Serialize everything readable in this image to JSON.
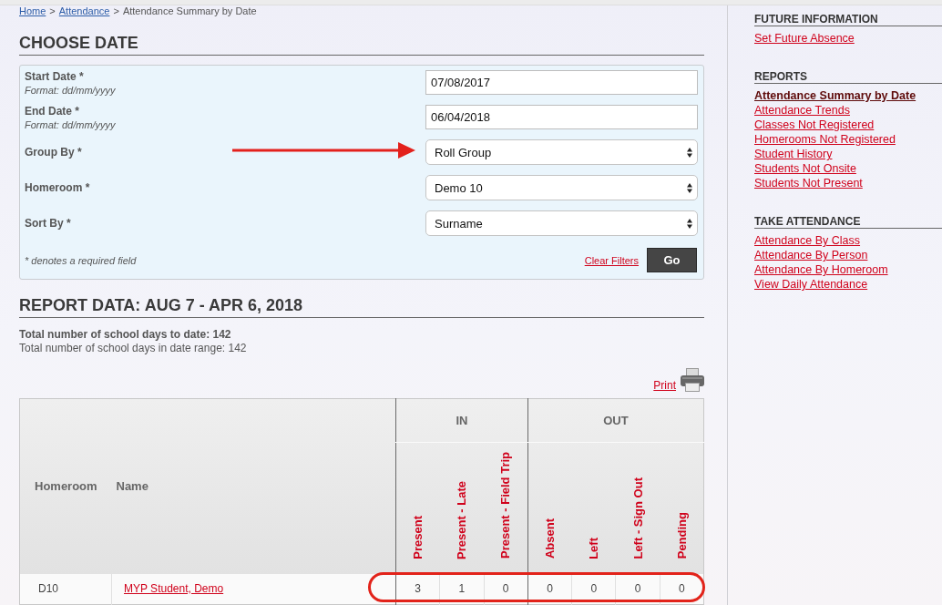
{
  "breadcrumb": {
    "separator": ">",
    "items": [
      {
        "label": "Home",
        "link": true
      },
      {
        "label": "Attendance",
        "link": true
      },
      {
        "label": "Attendance Summary by Date",
        "link": false
      }
    ]
  },
  "choose_date": {
    "title": "CHOOSE DATE",
    "fields": [
      {
        "kind": "text",
        "label": "Start Date *",
        "hint": "Format: dd/mm/yyyy",
        "value": "07/08/2017",
        "pointed": false
      },
      {
        "kind": "text",
        "label": "End Date *",
        "hint": "Format: dd/mm/yyyy",
        "value": "06/04/2018",
        "pointed": false
      },
      {
        "kind": "select",
        "label": "Group By *",
        "value": "Roll Group",
        "pointed": true
      },
      {
        "kind": "select",
        "label": "Homeroom *",
        "value": "Demo 10",
        "pointed": false
      },
      {
        "kind": "select",
        "label": "Sort By *",
        "value": "Surname",
        "pointed": false
      }
    ],
    "note": "* denotes a required field",
    "clear_link": "Clear Filters",
    "go_button": "Go"
  },
  "report": {
    "title": "REPORT DATA: AUG 7 - APR 6, 2018",
    "summary": [
      {
        "text": "Total number of school days to date: 142",
        "bold": true
      },
      {
        "text": "Total number of school days in date range: 142",
        "bold": false
      }
    ],
    "print_link": "Print",
    "table": {
      "columns": [
        "Homeroom",
        "Name"
      ],
      "groups": [
        {
          "label": "IN",
          "columns": [
            "Present",
            "Present - Late",
            "Present - Field Trip"
          ]
        },
        {
          "label": "OUT",
          "columns": [
            "Absent",
            "Left",
            "Left - Sign Out",
            "Pending"
          ]
        }
      ],
      "rows": [
        {
          "homeroom": "D10",
          "name": "MYP Student, Demo",
          "values": [
            "3",
            "1",
            "0",
            "0",
            "0",
            "0",
            "0"
          ],
          "circled": true
        }
      ]
    }
  },
  "sidebar": {
    "sections": [
      {
        "title": "FUTURE INFORMATION",
        "items": [
          {
            "label": "Set Future Absence",
            "selected": false
          }
        ]
      },
      {
        "title": "REPORTS",
        "items": [
          {
            "label": "Attendance Summary by Date",
            "selected": true
          },
          {
            "label": "Attendance Trends",
            "selected": false
          },
          {
            "label": "Classes Not Registered",
            "selected": false
          },
          {
            "label": "Homerooms Not Registered",
            "selected": false
          },
          {
            "label": "Student History",
            "selected": false
          },
          {
            "label": "Students Not Onsite",
            "selected": false
          },
          {
            "label": "Students Not Present",
            "selected": false
          }
        ]
      },
      {
        "title": "TAKE ATTENDANCE",
        "items": [
          {
            "label": "Attendance By Class",
            "selected": false
          },
          {
            "label": "Attendance By Person",
            "selected": false
          },
          {
            "label": "Attendance By Homeroom",
            "selected": false
          },
          {
            "label": "View Daily Attendance",
            "selected": false
          }
        ]
      }
    ]
  }
}
